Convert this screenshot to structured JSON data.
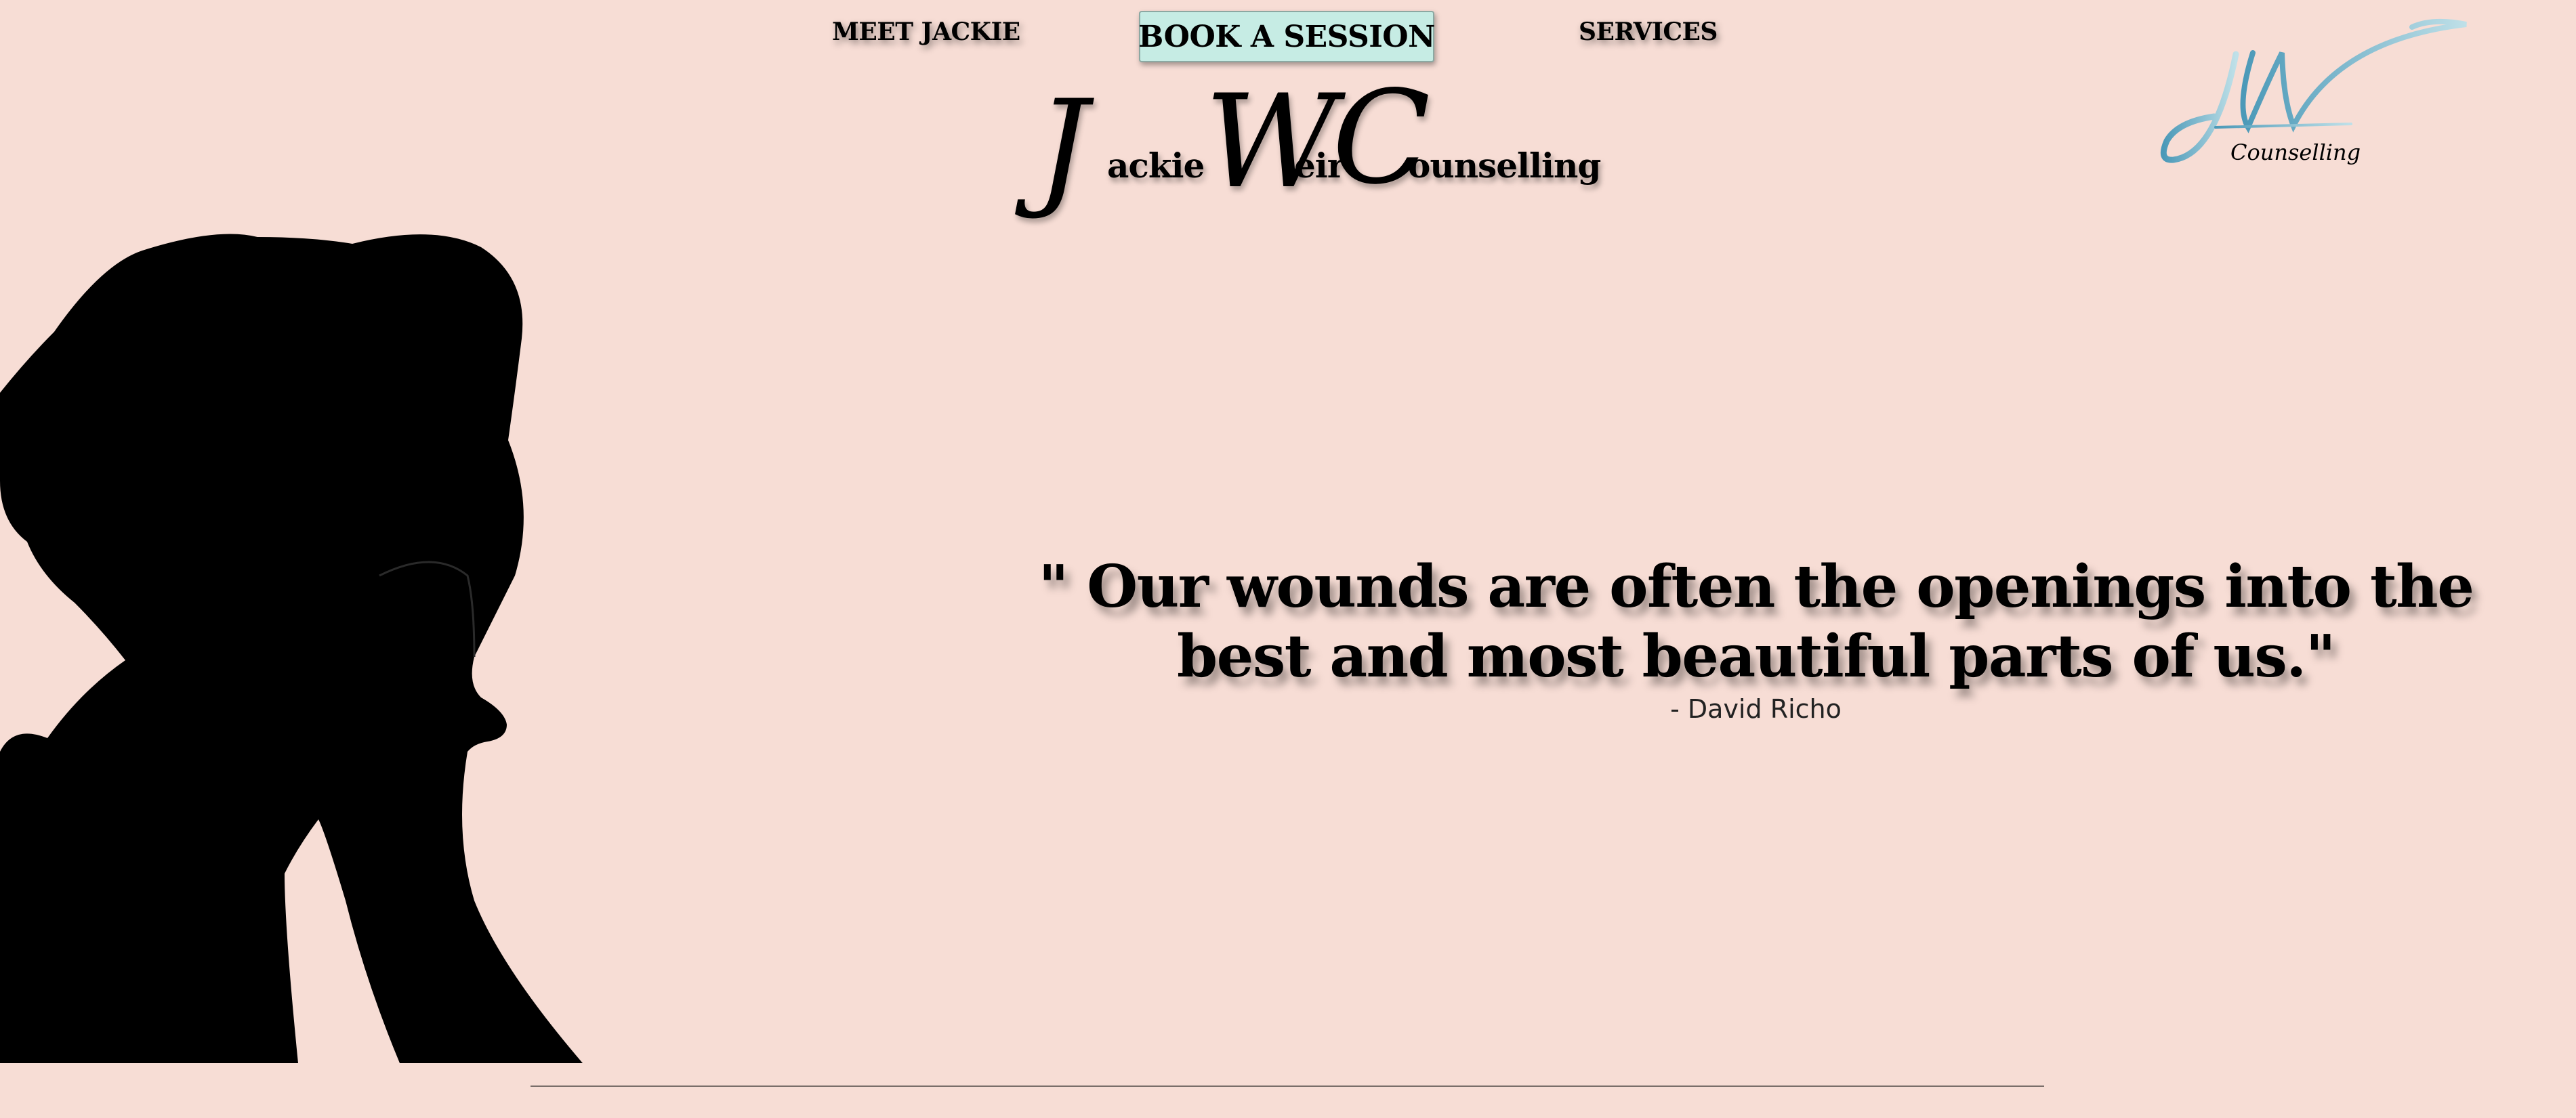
{
  "nav": {
    "meet_label": "MEET JACKIE",
    "book_label": "BOOK A SESSION",
    "services_label": "SERVICES"
  },
  "brand": {
    "cap_j": "J",
    "word_ackie": "ackie",
    "cap_w": "W",
    "word_eir": "eir",
    "cap_c": "C",
    "word_ounselling": "ounselling"
  },
  "logo": {
    "subtitle": "Counselling"
  },
  "quote": {
    "text": "\" Our wounds are often the openings into the best and most beautiful parts of us.\"",
    "author": "- David Richo"
  },
  "colors": {
    "background": "#f7ddd5",
    "button": "#c6ece4",
    "logo_accent": "#5aa8c4"
  },
  "icons": {
    "logo": "jw-monogram-icon",
    "hero": "silhouette-image"
  }
}
